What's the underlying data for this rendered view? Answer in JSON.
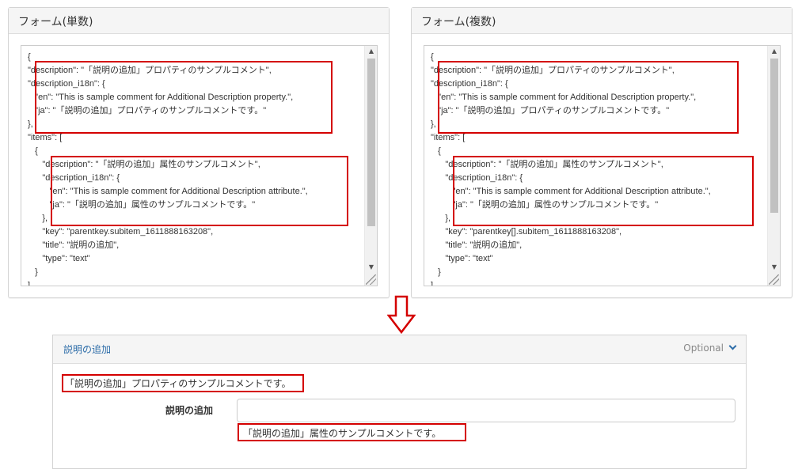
{
  "panels": {
    "single": {
      "title": "フォーム(単数)",
      "lines": [
        "{",
        "\"description\": \"「説明の追加」プロパティのサンプルコメント\",",
        "\"description_i18n\": {",
        "   \"en\": \"This is sample comment for Additional Description property.\",",
        "   \"ja\": \"「説明の追加」プロパティのサンプルコメントです。\"",
        "},",
        "\"items\": [",
        "   {",
        "      \"description\": \"「説明の追加」属性のサンプルコメント\",",
        "      \"description_i18n\": {",
        "         \"en\": \"This is sample comment for Additional Description attribute.\",",
        "         \"ja\": \"「説明の追加」属性のサンプルコメントです。\"",
        "      },",
        "      \"key\": \"parentkey.subitem_1611888163208\",",
        "      \"title\": \"説明の追加\",",
        "      \"type\": \"text\"",
        "   }",
        "]"
      ]
    },
    "multiple": {
      "title": "フォーム(複数)",
      "lines": [
        "{",
        "\"description\": \"「説明の追加」プロパティのサンプルコメント\",",
        "\"description_i18n\": {",
        "   \"en\": \"This is sample comment for Additional Description property.\",",
        "   \"ja\": \"「説明の追加」プロパティのサンプルコメントです。\"",
        "},",
        "\"items\": [",
        "   {",
        "      \"description\": \"「説明の追加」属性のサンプルコメント\",",
        "      \"description_i18n\": {",
        "         \"en\": \"This is sample comment for Additional Description attribute.\",",
        "         \"ja\": \"「説明の追加」属性のサンプルコメントです。\"",
        "      },",
        "      \"key\": \"parentkey[].subitem_1611888163208\",",
        "      \"title\": \"説明の追加\",",
        "      \"type\": \"text\"",
        "   }",
        "]"
      ]
    }
  },
  "preview": {
    "section_title": "説明の追加",
    "optional_label": "Optional",
    "description": "「説明の追加」プロパティのサンプルコメントです。",
    "field_label": "説明の追加",
    "field_value": "",
    "help_text": "「説明の追加」属性のサンプルコメントです。"
  },
  "colors": {
    "highlight": "#d40000",
    "accent": "#2c6ca8"
  }
}
